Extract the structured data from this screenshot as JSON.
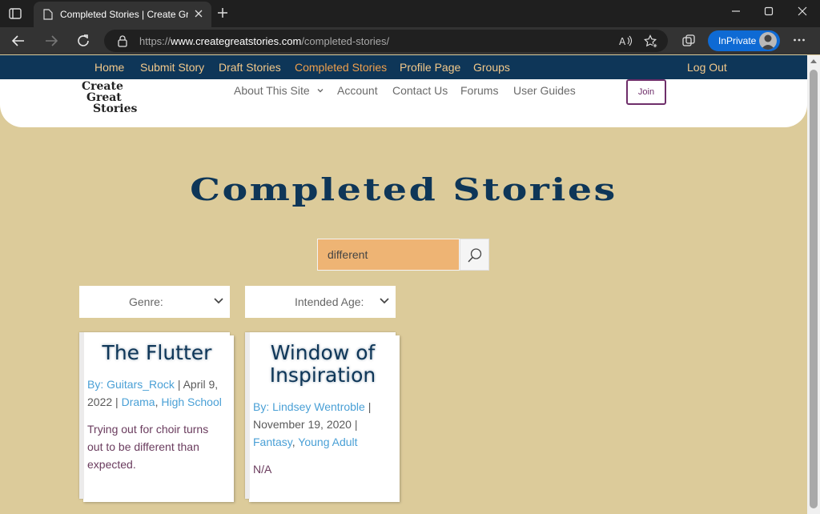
{
  "browser": {
    "tab_title": "Completed Stories | Create Great Stories",
    "url_prefix": "https://",
    "url_domain": "www.creategreatstories.com",
    "url_path": "/completed-stories/",
    "inprivate_label": "InPrivate"
  },
  "topnav": {
    "home": "Home",
    "submit_story": "Submit Story",
    "draft_stories": "Draft Stories",
    "completed_stories": "Completed Stories",
    "profile_page": "Profile Page",
    "groups": "Groups",
    "log_out": "Log Out"
  },
  "header": {
    "logo_line1": "Create",
    "logo_line2": "Great",
    "logo_line3": "Stories",
    "about": "About This Site",
    "account": "Account",
    "contact": "Contact Us",
    "forums": "Forums",
    "guides": "User Guides",
    "join": "Join"
  },
  "main": {
    "title": "Completed Stories",
    "search_value": "different",
    "genre_label": "Genre:",
    "age_label": "Intended Age:"
  },
  "cards": [
    {
      "title": "The Flutter",
      "by": "By:",
      "author": "Guitars_Rock",
      "sep1": " | ",
      "date": "April 9, 2022",
      "sep2": " | ",
      "genre": "Drama",
      "comma": ", ",
      "age": "High School",
      "excerpt": "Trying out for choir turns out to be different than expected."
    },
    {
      "title": "Window of Inspiration",
      "by": "By:",
      "author": "Lindsey Wentroble",
      "sep1": " | ",
      "date": "November 19, 2020",
      "sep2": " | ",
      "genre": "Fantasy",
      "comma": ", ",
      "age": "Young Adult",
      "excerpt": "N/A"
    }
  ],
  "colors": {
    "nav_bg": "#0e3658",
    "nav_link": "#f2c88a",
    "nav_active": "#ee9f4c",
    "page_bg": "#dccb9a",
    "search_bg": "#eeb474",
    "link_blue": "#4aa0d6"
  }
}
